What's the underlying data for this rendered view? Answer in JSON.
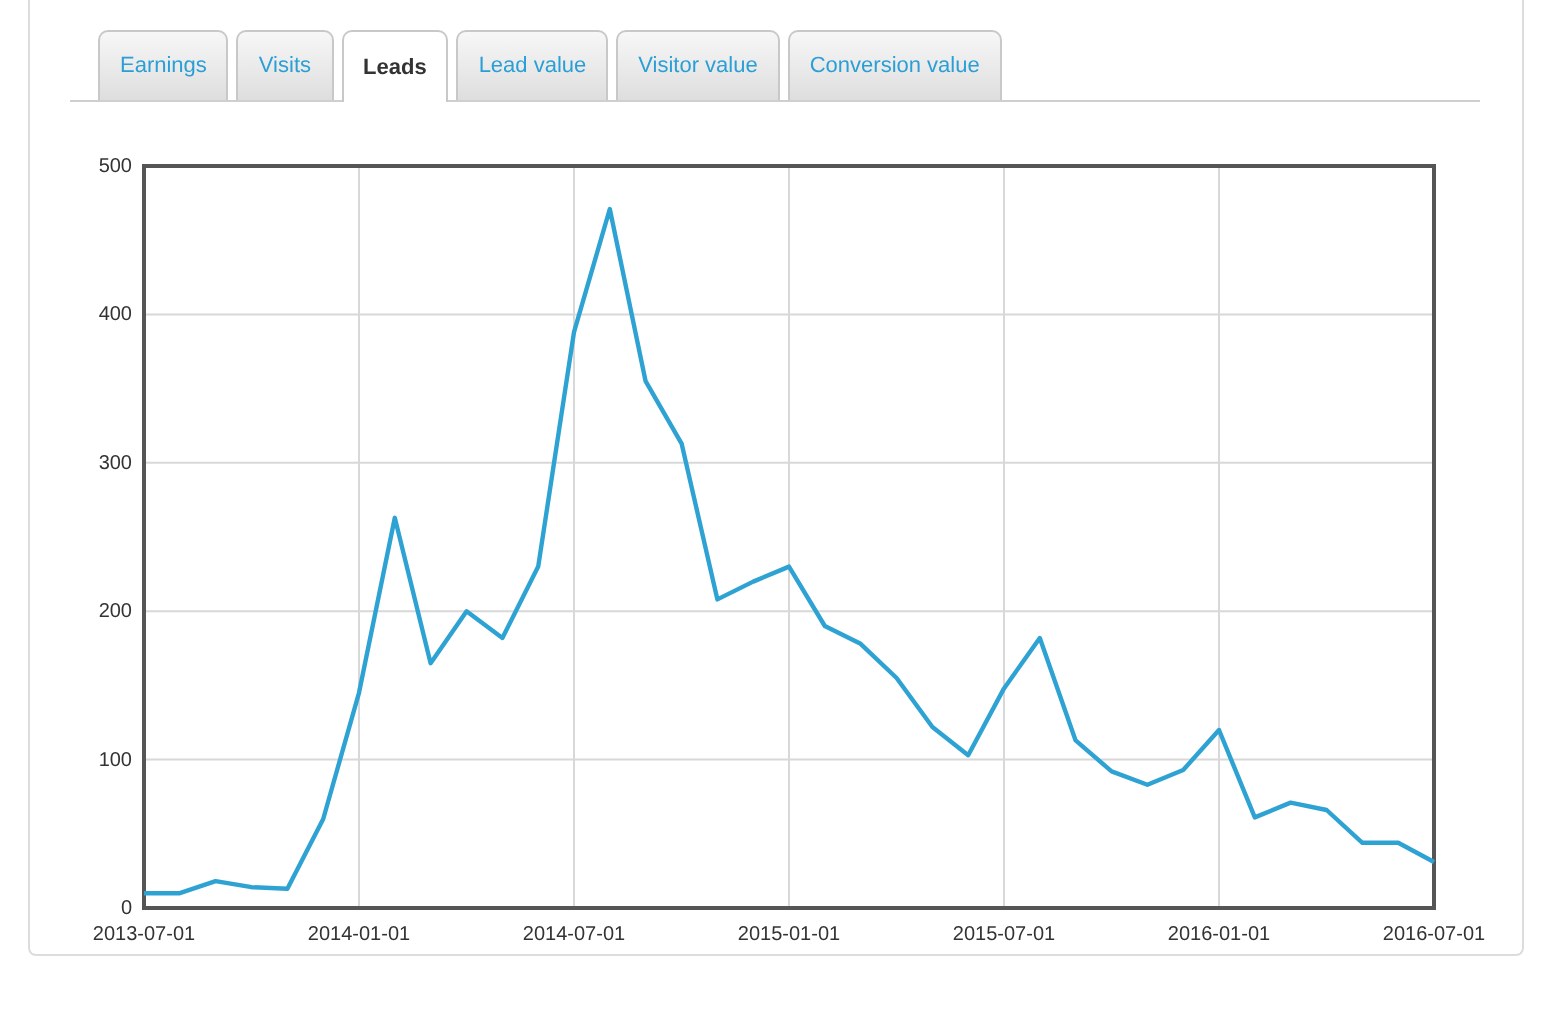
{
  "tabs": [
    {
      "label": "Earnings",
      "selected": false
    },
    {
      "label": "Visits",
      "selected": false
    },
    {
      "label": "Leads",
      "selected": true
    },
    {
      "label": "Lead value",
      "selected": false
    },
    {
      "label": "Visitor value",
      "selected": false
    },
    {
      "label": "Conversion value",
      "selected": false
    }
  ],
  "chart": {
    "chart_data": {
      "type": "line",
      "categories": [
        "2013-07-01",
        null,
        null,
        null,
        null,
        null,
        "2014-01-01",
        null,
        null,
        null,
        null,
        null,
        "2014-07-01",
        null,
        null,
        null,
        null,
        null,
        "2015-01-01",
        null,
        null,
        null,
        null,
        null,
        "2015-07-01",
        null,
        null,
        null,
        null,
        null,
        "2016-01-01",
        null,
        null,
        null,
        null,
        null,
        "2016-07-01"
      ],
      "series": [
        {
          "color": "#2ea3d3",
          "values": [
            10,
            10,
            18,
            14,
            13,
            60,
            145,
            263,
            165,
            200,
            182,
            230,
            388,
            471,
            355,
            313,
            208,
            220,
            230,
            190,
            178,
            155,
            122,
            103,
            148,
            182,
            113,
            92,
            83,
            93,
            120,
            61,
            71,
            66,
            44,
            44,
            31
          ]
        }
      ],
      "ylim": [
        0,
        500
      ],
      "grid": true,
      "yticks": [
        0,
        100,
        200,
        300,
        400,
        500
      ]
    }
  }
}
